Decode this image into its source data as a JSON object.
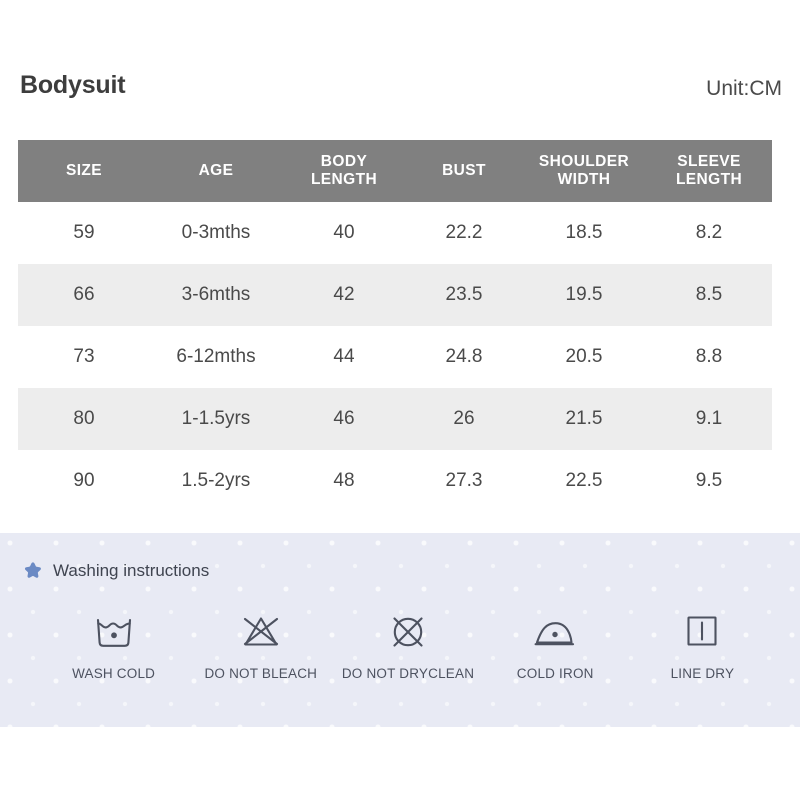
{
  "header": {
    "product_title": "Bodysuit",
    "unit_label": "Unit:CM"
  },
  "size_table": {
    "columns": [
      {
        "line1": "SIZE",
        "line2": ""
      },
      {
        "line1": "AGE",
        "line2": ""
      },
      {
        "line1": "BODY",
        "line2": "LENGTH"
      },
      {
        "line1": "BUST",
        "line2": ""
      },
      {
        "line1": "SHOULDER",
        "line2": "WIDTH"
      },
      {
        "line1": "SLEEVE",
        "line2": "LENGTH"
      }
    ],
    "rows": [
      {
        "size": "59",
        "age": "0-3mths",
        "body_length": "40",
        "bust": "22.2",
        "shoulder_width": "18.5",
        "sleeve_length": "8.2"
      },
      {
        "size": "66",
        "age": "3-6mths",
        "body_length": "42",
        "bust": "23.5",
        "shoulder_width": "19.5",
        "sleeve_length": "8.5"
      },
      {
        "size": "73",
        "age": "6-12mths",
        "body_length": "44",
        "bust": "24.8",
        "shoulder_width": "20.5",
        "sleeve_length": "8.8"
      },
      {
        "size": "80",
        "age": "1-1.5yrs",
        "body_length": "46",
        "bust": "26",
        "shoulder_width": "21.5",
        "sleeve_length": "9.1"
      },
      {
        "size": "90",
        "age": "1.5-2yrs",
        "body_length": "48",
        "bust": "27.3",
        "shoulder_width": "22.5",
        "sleeve_length": "9.5"
      }
    ]
  },
  "washing": {
    "heading": "Washing instructions",
    "star_icon": "star-icon",
    "items": [
      {
        "icon": "wash-tub-cold-icon",
        "label": "WASH COLD"
      },
      {
        "icon": "do-not-bleach-icon",
        "label": "DO NOT BLEACH"
      },
      {
        "icon": "do-not-dryclean-icon",
        "label": "DO NOT DRYCLEAN"
      },
      {
        "icon": "iron-cold-icon",
        "label": "COLD IRON"
      },
      {
        "icon": "line-dry-icon",
        "label": "LINE DRY"
      }
    ]
  },
  "colors": {
    "header_bar": "#808080",
    "row_stripe": "#ededed",
    "panel_background": "#e8eaf4",
    "star_blue": "#6b8ac4",
    "text_dark": "#4a4a4a",
    "icon_stroke": "#4d5260"
  }
}
